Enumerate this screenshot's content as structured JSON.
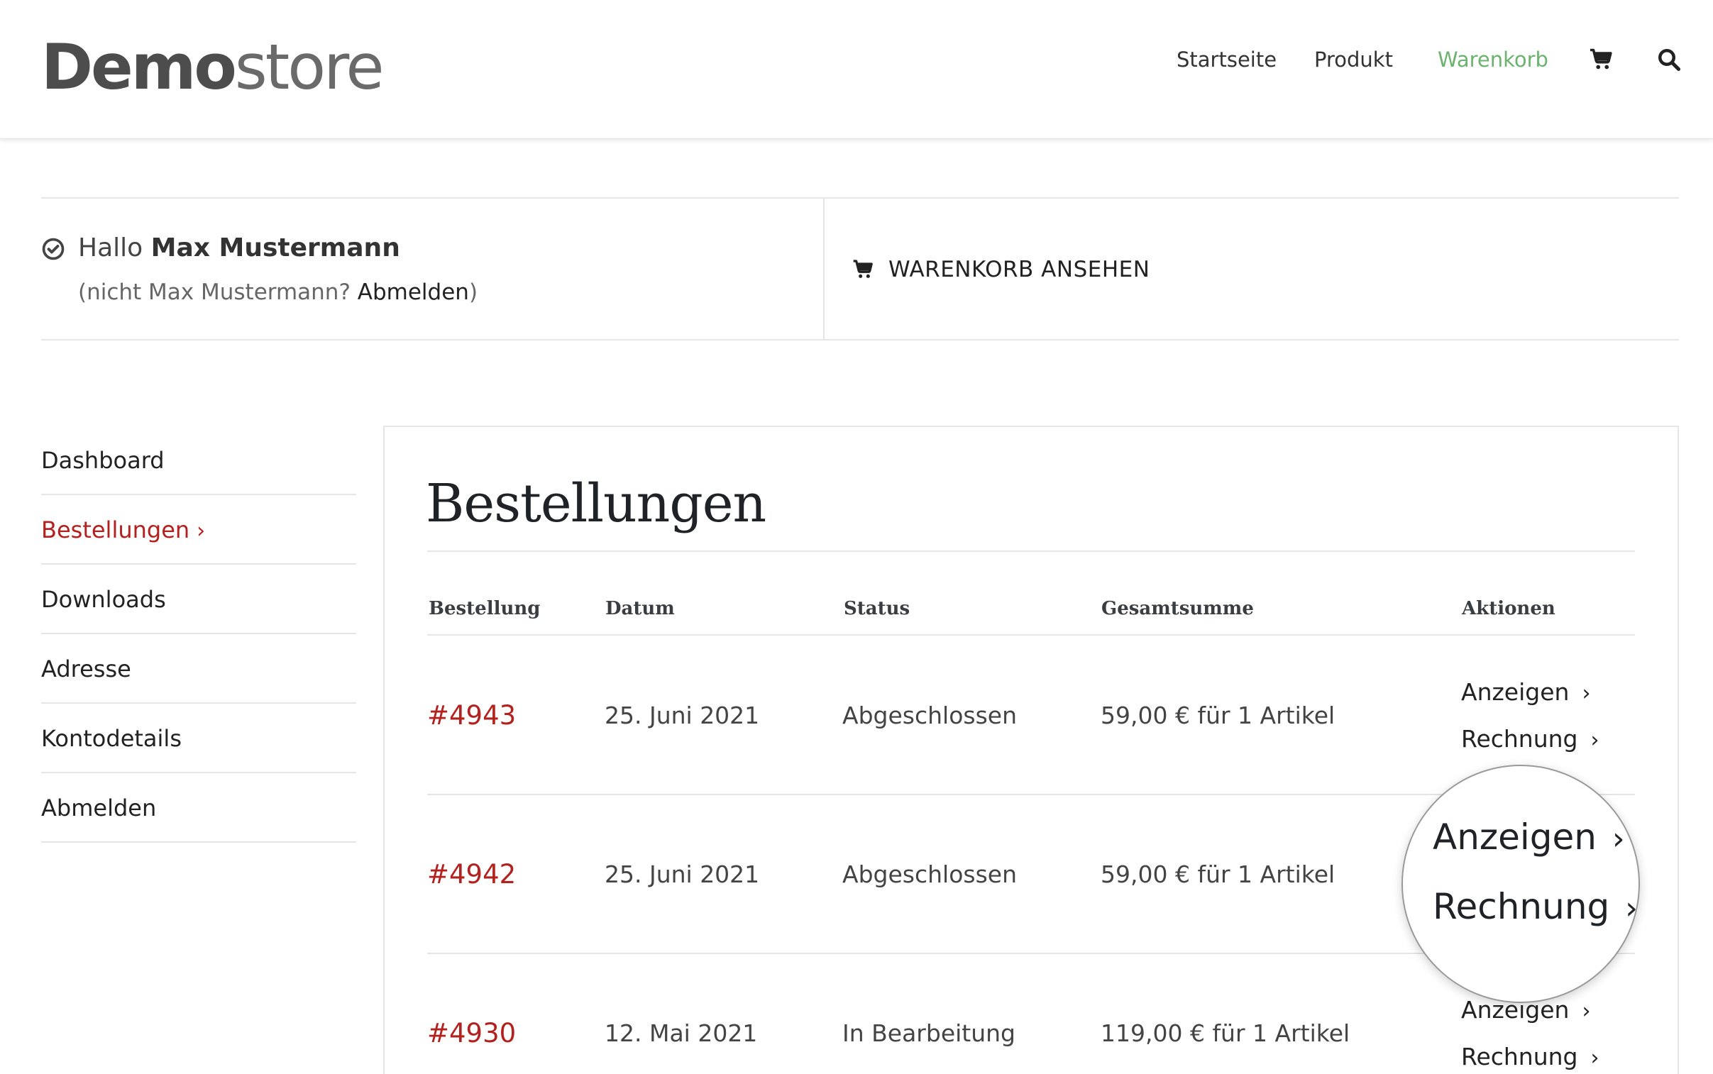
{
  "header": {
    "logo_bold": "Demo",
    "logo_light": "store",
    "nav": [
      {
        "label": "Startseite",
        "active": false
      },
      {
        "label": "Produkt",
        "active": false
      },
      {
        "label": "Warenkorb",
        "active": true
      }
    ],
    "icons": [
      "cart-icon",
      "search-icon"
    ]
  },
  "greeting": {
    "hello": "Hallo",
    "name": "Max Mustermann",
    "not_user_prefix": "(nicht Max Mustermann?",
    "logout_link": "Abmelden",
    "not_user_suffix": ")",
    "cart_button": "WARENKORB ANSEHEN"
  },
  "sidebar": {
    "items": [
      {
        "label": "Dashboard",
        "active": false
      },
      {
        "label": "Bestellungen",
        "active": true
      },
      {
        "label": "Downloads",
        "active": false
      },
      {
        "label": "Adresse",
        "active": false
      },
      {
        "label": "Kontodetails",
        "active": false
      },
      {
        "label": "Abmelden",
        "active": false
      }
    ]
  },
  "orders": {
    "title": "Bestellungen",
    "columns": [
      "Bestellung",
      "Datum",
      "Status",
      "Gesamtsumme",
      "Aktionen"
    ],
    "rows": [
      {
        "id": "#4943",
        "date": "25. Juni 2021",
        "status": "Abgeschlossen",
        "total": "59,00 € für 1 Artikel",
        "actions": [
          "Anzeigen",
          "Rechnung"
        ]
      },
      {
        "id": "#4942",
        "date": "25. Juni 2021",
        "status": "Abgeschlossen",
        "total": "59,00 € für 1 Artikel",
        "actions": [
          "Anzeigen",
          "Rechnung"
        ]
      },
      {
        "id": "#4930",
        "date": "12. Mai 2021",
        "status": "In Bearbeitung",
        "total": "119,00 € für 1 Artikel",
        "actions": [
          "Anzeigen",
          "Rechnung"
        ]
      }
    ]
  },
  "magnifier": {
    "actions": [
      "Anzeigen",
      "Rechnung"
    ]
  },
  "colors": {
    "accent_green": "#6bb36e",
    "accent_red": "#b3211e",
    "text": "#333333",
    "rule": "#e5e5e5"
  }
}
